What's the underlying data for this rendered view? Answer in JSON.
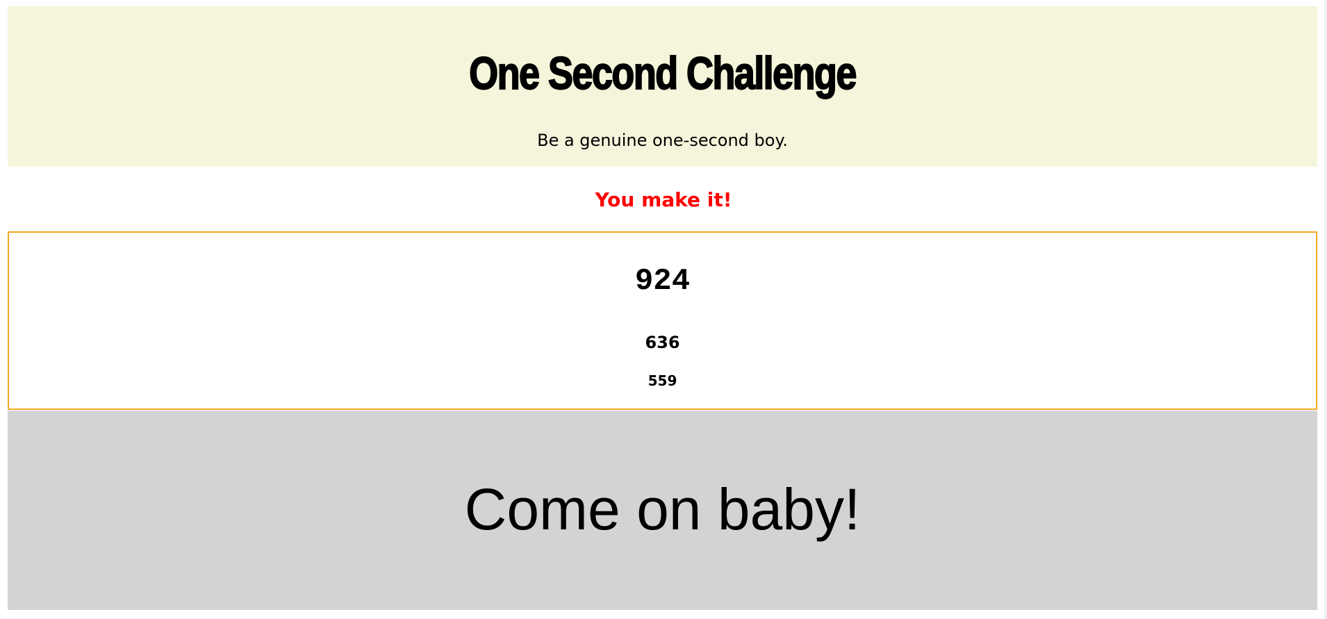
{
  "header": {
    "title": "One Second Challenge",
    "subtitle": "Be a genuine one-second boy."
  },
  "result": {
    "message": "You make it!",
    "color": "#ff0000"
  },
  "scores": {
    "current": "924",
    "history": [
      "636",
      "559"
    ]
  },
  "action": {
    "label": "Come on baby!"
  },
  "colors": {
    "header_background": "#f5f5dc",
    "score_border": "#f4a81f",
    "action_background": "#d3d3d3"
  }
}
